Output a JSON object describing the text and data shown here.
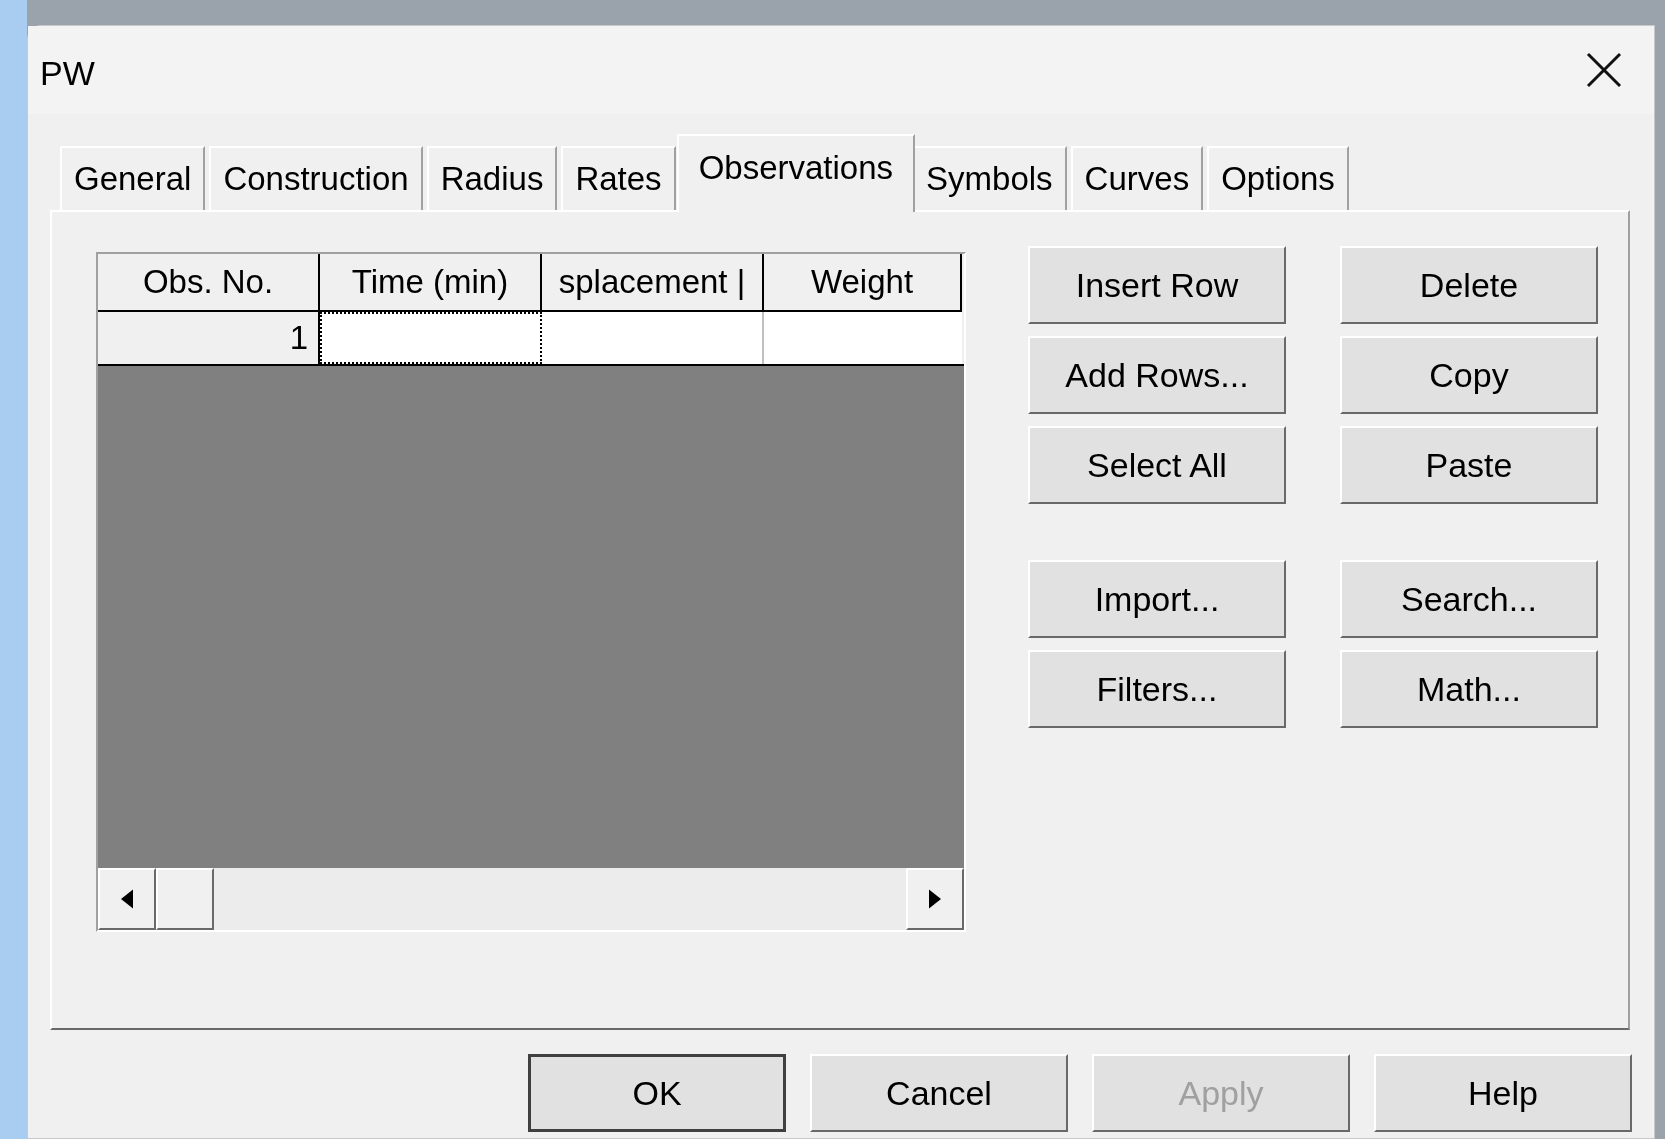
{
  "window": {
    "title": "PW"
  },
  "tabs": [
    {
      "label": "General",
      "selected": false
    },
    {
      "label": "Construction",
      "selected": false
    },
    {
      "label": "Radius",
      "selected": false
    },
    {
      "label": "Rates",
      "selected": false
    },
    {
      "label": "Observations",
      "selected": true
    },
    {
      "label": "Symbols",
      "selected": false
    },
    {
      "label": "Curves",
      "selected": false
    },
    {
      "label": "Options",
      "selected": false
    }
  ],
  "grid": {
    "columns": [
      "Obs. No.",
      "Time (min)",
      "splacement |",
      "Weight"
    ],
    "rows": [
      {
        "number": "1"
      }
    ]
  },
  "button_groups": [
    [
      "Insert Row",
      "Delete",
      "Add Rows...",
      "Copy",
      "Select All",
      "Paste"
    ],
    [
      "Import...",
      "Search...",
      "Filters...",
      "Math..."
    ]
  ],
  "dialog_buttons": [
    {
      "label": "OK",
      "default": true,
      "disabled": false
    },
    {
      "label": "Cancel",
      "default": false,
      "disabled": false
    },
    {
      "label": "Apply",
      "default": false,
      "disabled": true
    },
    {
      "label": "Help",
      "default": false,
      "disabled": false
    }
  ]
}
